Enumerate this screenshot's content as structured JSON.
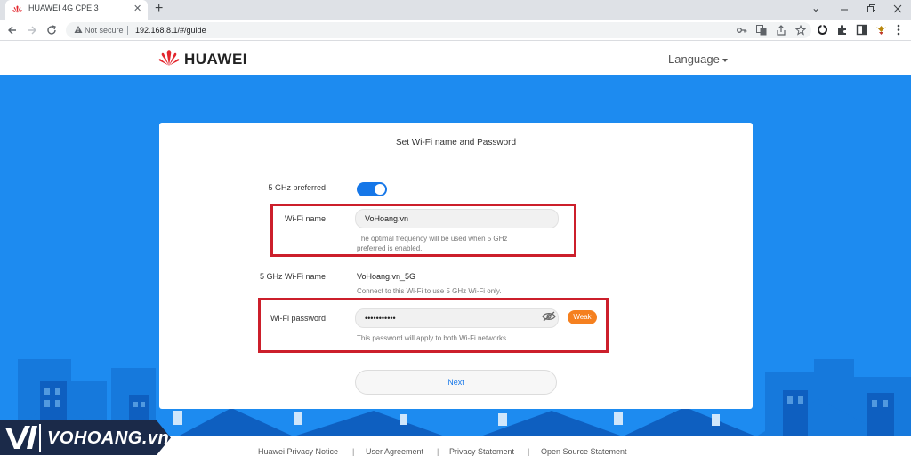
{
  "browser": {
    "tab_title": "HUAWEI 4G CPE 3",
    "tab_close": "✕",
    "new_tab": "+",
    "minimize": "⌄",
    "not_secure": "Not secure",
    "url": "192.168.8.1/#/guide"
  },
  "header": {
    "brand": "HUAWEI",
    "language": "Language"
  },
  "card": {
    "title": "Set Wi-Fi name and Password",
    "ghz_preferred_label": "5 GHz preferred",
    "ghz_preferred_on": true,
    "wifi_name_label": "Wi-Fi name",
    "wifi_name_value": "VoHoang.vn",
    "wifi_name_hint_1": "The optimal frequency will be used when 5 GHz",
    "wifi_name_hint_2": "preferred is enabled.",
    "ghz_name_label": "5 GHz Wi-Fi name",
    "ghz_name_value": "VoHoang.vn_5G",
    "ghz_name_hint": "Connect to this Wi-Fi to use 5 GHz Wi-Fi only.",
    "password_label": "Wi-Fi password",
    "password_value": "•••••••••••",
    "password_strength": "Weak",
    "password_hint": "This password will apply to both Wi-Fi networks",
    "next_label": "Next"
  },
  "footer": {
    "links": [
      "Huawei Privacy Notice",
      "User Agreement",
      "Privacy Statement",
      "Open Source Statement"
    ],
    "separator": "|"
  },
  "watermark": {
    "text": "VOHOANG.vn"
  },
  "colors": {
    "background_blue": "#1d8bf0",
    "accent_blue": "#1677e8",
    "highlight_red": "#cc1f2b",
    "weak_orange": "#f5801f"
  }
}
